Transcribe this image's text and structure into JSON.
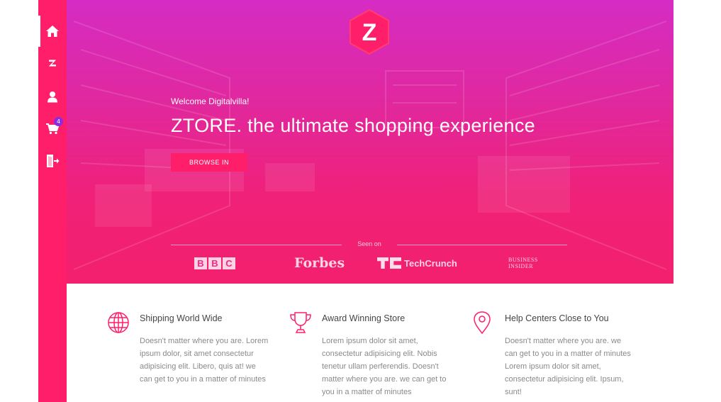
{
  "theme": {
    "accent": "#ff1e6a",
    "hero_top": "#d52cc4",
    "hero_bottom": "#f3206d",
    "badge": "#8a2be2"
  },
  "sidebar": {
    "items": [
      {
        "name": "home",
        "icon": "home-icon",
        "active": true
      },
      {
        "name": "brand",
        "icon": "ztore-logo-icon",
        "active": false
      },
      {
        "name": "account",
        "icon": "user-icon",
        "active": false
      },
      {
        "name": "cart",
        "icon": "cart-icon",
        "active": false,
        "badge": "4"
      },
      {
        "name": "logout",
        "icon": "logout-icon",
        "active": false
      }
    ]
  },
  "hero": {
    "logo_letter": "Z",
    "welcome": "Welcome Digitalvilla!",
    "headline": "ZTORE. the ultimate shopping experience",
    "browse_label": "BROWSE IN",
    "seen_on": "Seen on",
    "brands": {
      "bbc": [
        "B",
        "B",
        "C"
      ],
      "forbes": "Forbes",
      "techcrunch": "TechCrunch",
      "bi_line1": "BUSINESS",
      "bi_line2": "INSIDER"
    }
  },
  "features": [
    {
      "icon": "globe-icon",
      "title": "Shipping World Wide",
      "text": "Doesn't matter where you are. Lorem ipsum dolor, sit amet consectetur adipisicing elit. Libero, quis at! we can get to you in a matter of minutes"
    },
    {
      "icon": "trophy-icon",
      "title": "Award Winning Store",
      "text": "Lorem ipsum dolor sit amet, consectetur adipisicing elit. Nobis tenetur ullam perferendis. Doesn't matter where you are. we can get to you in a matter of minutes"
    },
    {
      "icon": "location-pin-icon",
      "title": "Help Centers Close to You",
      "text": "Doesn't matter where you are. we can get to you in a matter of minutes Lorem ipsum dolor sit amet, consectetur adipisicing elit. Ipsum, sunt!"
    }
  ]
}
